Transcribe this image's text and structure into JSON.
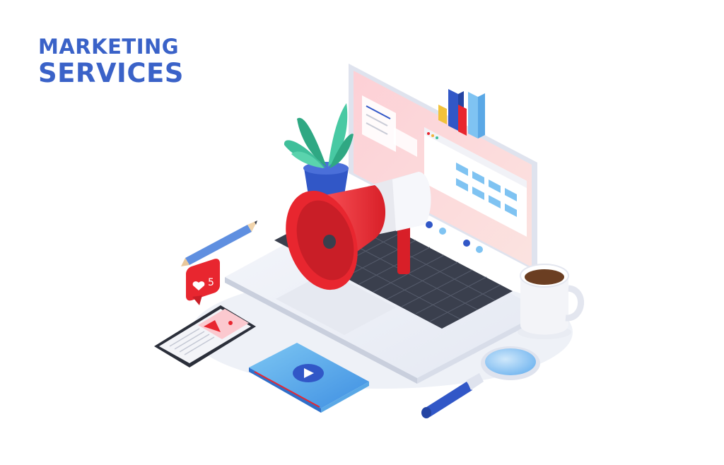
{
  "title": {
    "line1": "MARKETING",
    "line2": "SERVICES"
  },
  "notification": {
    "like_count": "5"
  },
  "colors": {
    "brand_blue": "#3a62c8",
    "megaphone_red": "#e8262f",
    "screen_pink": "#fbc9cf",
    "plant_green": "#3fbf9a",
    "pot_blue": "#3157c7"
  },
  "icons": [
    "megaphone-icon",
    "heart-icon",
    "play-icon",
    "magnifier-icon",
    "pencil-icon",
    "coffee-cup-icon",
    "bar-chart-icon",
    "plant-icon",
    "smartphone-icon"
  ]
}
